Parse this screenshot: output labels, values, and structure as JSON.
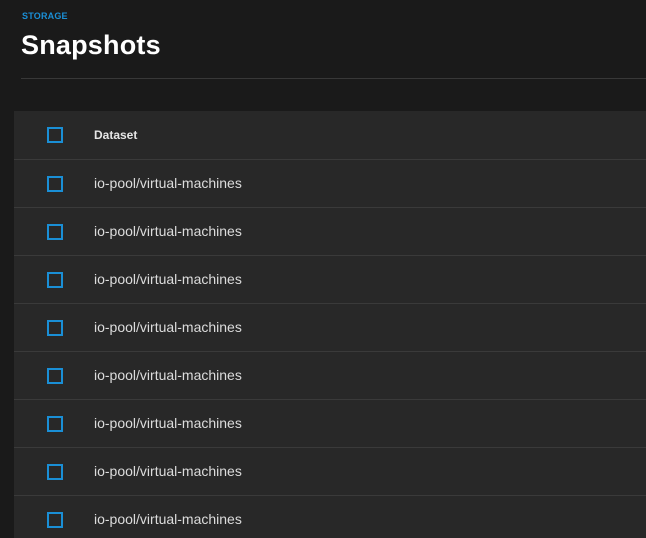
{
  "breadcrumb": "STORAGE",
  "page_title": "Snapshots",
  "table": {
    "columns": [
      "Dataset"
    ],
    "rows": [
      {
        "dataset": "io-pool/virtual-machines"
      },
      {
        "dataset": "io-pool/virtual-machines"
      },
      {
        "dataset": "io-pool/virtual-machines"
      },
      {
        "dataset": "io-pool/virtual-machines"
      },
      {
        "dataset": "io-pool/virtual-machines"
      },
      {
        "dataset": "io-pool/virtual-machines"
      },
      {
        "dataset": "io-pool/virtual-machines"
      },
      {
        "dataset": "io-pool/virtual-machines"
      }
    ]
  },
  "colors": {
    "accent": "#1a8fd6",
    "background": "#1a1a1a",
    "table_background": "#282828"
  }
}
